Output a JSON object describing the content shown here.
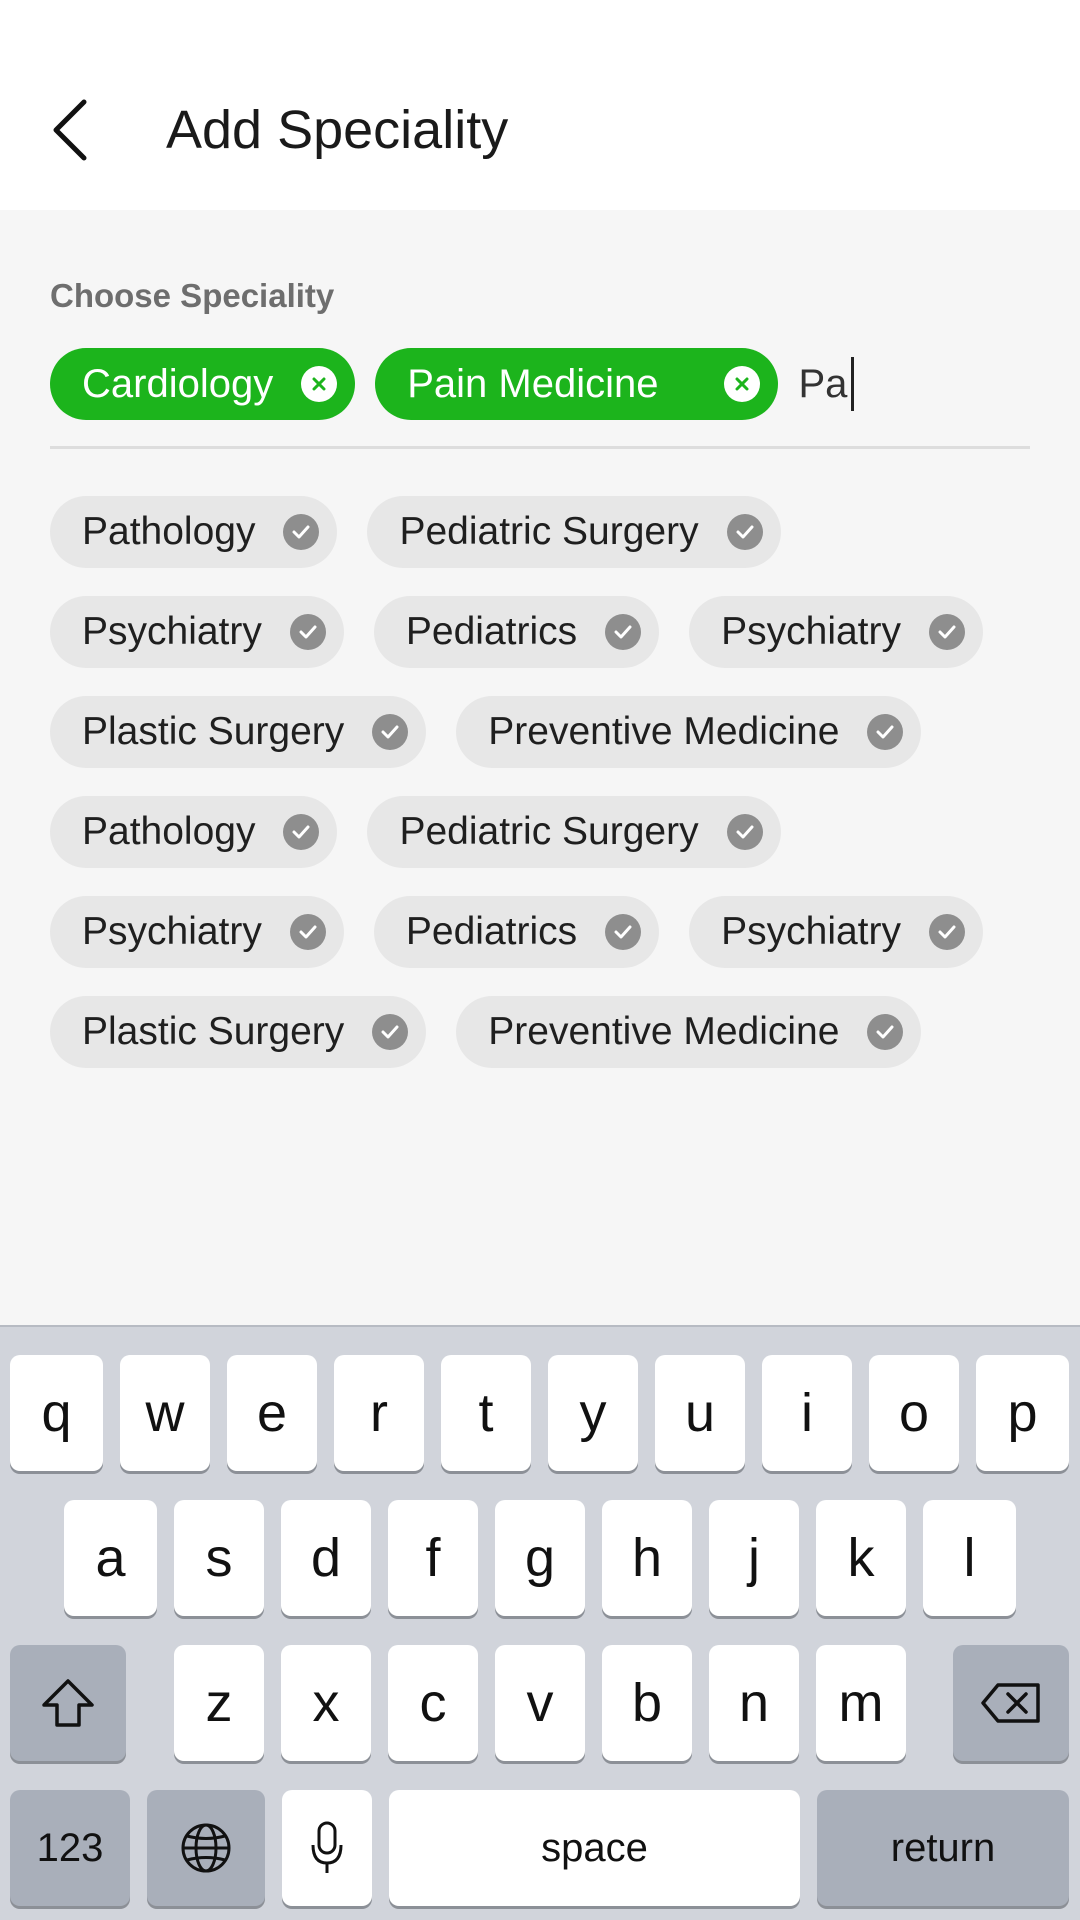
{
  "header": {
    "title": "Add Speciality",
    "back_icon": "chevron-left-icon"
  },
  "form": {
    "section_label": "Choose Speciality",
    "selected": [
      "Cardiology",
      "Pain Medicine"
    ],
    "search_value": "Pa"
  },
  "suggestions": [
    [
      "Pathology",
      "Pediatric Surgery"
    ],
    [
      "Psychiatry",
      "Pediatrics",
      "Psychiatry"
    ],
    [
      "Plastic Surgery",
      "Preventive Medicine"
    ],
    [
      "Pathology",
      "Pediatric Surgery"
    ],
    [
      "Psychiatry",
      "Pediatrics",
      "Psychiatry"
    ],
    [
      "Plastic Surgery",
      "Preventive Medicine"
    ]
  ],
  "keyboard": {
    "row1": [
      "q",
      "w",
      "e",
      "r",
      "t",
      "y",
      "u",
      "i",
      "o",
      "p"
    ],
    "row2": [
      "a",
      "s",
      "d",
      "f",
      "g",
      "h",
      "j",
      "k",
      "l"
    ],
    "row3": [
      "z",
      "x",
      "c",
      "v",
      "b",
      "n",
      "m"
    ],
    "numbers_label": "123",
    "space_label": "space",
    "return_label": "return"
  },
  "colors": {
    "accent_green": "#1cb41c",
    "chip_gray": "#e7e7e7",
    "keyboard_bg": "#d1d4db"
  }
}
